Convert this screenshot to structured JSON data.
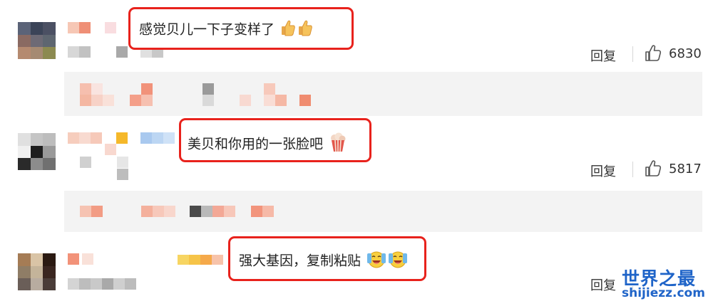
{
  "comments": [
    {
      "text": "感觉贝儿一下子变样了",
      "emojis": [
        "thumbs-up",
        "thumbs-up"
      ],
      "reply_label": "回复",
      "likes": "6830"
    },
    {
      "text": "美贝和你用的一张脸吧",
      "emojis": [
        "popcorn"
      ],
      "reply_label": "回复",
      "likes": "5817"
    },
    {
      "text": "强大基因，复制粘贴",
      "emojis": [
        "crying-laughing",
        "crying-laughing"
      ],
      "reply_label": "回复"
    }
  ],
  "watermark": {
    "title": "世界之最",
    "url": "shijiezz.com"
  },
  "colors": {
    "highlight_border": "#e8221c",
    "watermark": "#1f64c8",
    "subpanel_bg": "#f3f3f3"
  }
}
